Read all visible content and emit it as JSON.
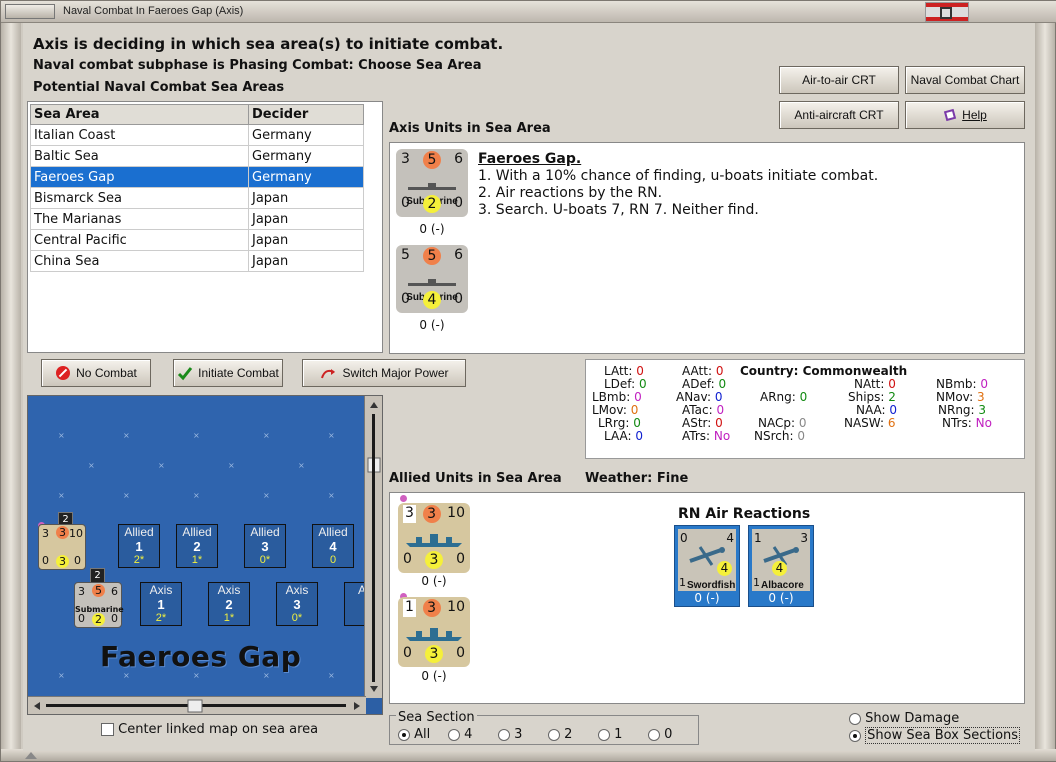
{
  "window": {
    "title": "Naval Combat In Faeroes Gap (Axis)"
  },
  "header": {
    "main": "Axis is deciding in which sea area(s) to initiate combat.",
    "subphase": "Naval combat subphase is Phasing Combat: Choose Sea Area",
    "potential": "Potential Naval Combat Sea Areas"
  },
  "buttons": {
    "air_to_air": "Air-to-air CRT",
    "naval_chart": "Naval Combat Chart",
    "anti_aircraft": "Anti-aircraft CRT",
    "help": "Help",
    "no_combat": "No Combat",
    "initiate": "Initiate Combat",
    "switch": "Switch Major Power"
  },
  "sea_table": {
    "headers": [
      "Sea Area",
      "Decider"
    ],
    "rows": [
      [
        "Italian Coast",
        "Germany"
      ],
      [
        "Baltic Sea",
        "Germany"
      ],
      [
        "Faeroes Gap",
        "Germany"
      ],
      [
        "Bismarck Sea",
        "Japan"
      ],
      [
        "The Marianas",
        "Japan"
      ],
      [
        "Central Pacific",
        "Japan"
      ],
      [
        "China Sea",
        "Japan"
      ]
    ],
    "selected": 2
  },
  "axis": {
    "label": "Axis Units in Sea Area",
    "units": [
      {
        "tl": "3",
        "tc": "5",
        "tr": "6",
        "name": "Submarine",
        "bl": "0",
        "bc": "2",
        "br": "0",
        "below": "0 (-)"
      },
      {
        "tl": "5",
        "tc": "5",
        "tr": "6",
        "name": "Submarine",
        "bl": "0",
        "bc": "4",
        "br": "0",
        "below": "0 (-)"
      }
    ],
    "info_title": "Faeroes Gap.",
    "info_lines": [
      "1. With a 10% chance of finding, u-boats initiate combat.",
      "2. Air reactions by the RN.",
      "3. Search. U-boats 7, RN 7.  Neither find."
    ]
  },
  "stats": {
    "country": "Country: Commonwealth",
    "col1": [
      [
        "LAtt:",
        "0"
      ],
      [
        "LDef:",
        "0"
      ],
      [
        "LBmb:",
        "0"
      ],
      [
        "LMov:",
        "0"
      ],
      [
        "LRrg:",
        "0"
      ],
      [
        "LAA:",
        "0"
      ]
    ],
    "col2": [
      [
        "AAtt:",
        "0"
      ],
      [
        "ADef:",
        "0"
      ],
      [
        "ANav:",
        "0"
      ],
      [
        "ATac:",
        "0"
      ],
      [
        "AStr:",
        "0"
      ],
      [
        "ATrs:",
        "No"
      ]
    ],
    "col3": [
      [
        "ARng:",
        "0"
      ],
      [
        "NACp:",
        "0"
      ],
      [
        "NSrch:",
        "0"
      ]
    ],
    "col4": [
      [
        "NAtt:",
        "0"
      ],
      [
        "Ships:",
        "2"
      ],
      [
        "NAA:",
        "0"
      ],
      [
        "NASW:",
        "6"
      ]
    ],
    "col5": [
      [
        "NBmb:",
        "0"
      ],
      [
        "NMov:",
        "3"
      ],
      [
        "NRng:",
        "3"
      ],
      [
        "NTrs:",
        "No"
      ]
    ]
  },
  "map": {
    "title": "Faeroes Gap",
    "allied_zones": [
      {
        "label": "Allied",
        "n": "1",
        "s": "2*"
      },
      {
        "label": "Allied",
        "n": "2",
        "s": "1*"
      },
      {
        "label": "Allied",
        "n": "3",
        "s": "0*"
      },
      {
        "label": "Allied",
        "n": "4",
        "s": "0"
      }
    ],
    "axis_zones": [
      {
        "label": "Axis",
        "n": "1",
        "s": "2*"
      },
      {
        "label": "Axis",
        "n": "2",
        "s": "1*"
      },
      {
        "label": "Axis",
        "n": "3",
        "s": "0*"
      },
      {
        "label": "Ax",
        "n": "",
        "s": ""
      }
    ],
    "stack_allied": "2",
    "stack_axis": "2",
    "sub_name": "Submarine",
    "center_label": "Center linked map on sea area"
  },
  "allied": {
    "label": "Allied Units in Sea Area",
    "weather": "Weather:  Fine",
    "ships": [
      {
        "tl": "3",
        "tc": "3",
        "tr": "10",
        "bl": "0",
        "bc": "3",
        "br": "0",
        "below": "0 (-)"
      },
      {
        "tl": "1",
        "tc": "3",
        "tr": "10",
        "bl": "0",
        "bc": "3",
        "br": "0",
        "below": "0 (-)"
      }
    ],
    "air_title": "RN Air Reactions",
    "air": [
      {
        "tl": "0",
        "tr": "4",
        "bc": "4",
        "bl": "1",
        "name": "Swordfish",
        "below": "0 (-)"
      },
      {
        "tl": "1",
        "tr": "3",
        "bc": "4",
        "bl": "1",
        "name": "Albacore",
        "below": "0 (-)"
      }
    ]
  },
  "sea_section": {
    "legend": "Sea Section",
    "options": [
      "All",
      "4",
      "3",
      "2",
      "1",
      "0"
    ],
    "selected": 0
  },
  "show": {
    "damage": "Show Damage",
    "sections": "Show Sea Box Sections"
  }
}
